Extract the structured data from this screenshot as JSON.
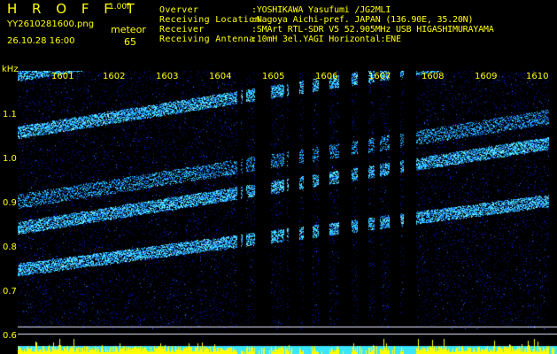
{
  "header": {
    "brand": "H R O F F T",
    "version": "1.00f",
    "filename": "YY2610281600.png",
    "timestamp": "26.10.28 16:00",
    "meteor_label": "meteor",
    "meteor_count": "65"
  },
  "station": {
    "labels": [
      "Overver",
      "Receiving Location",
      "Receiver",
      "Receiving Antenna"
    ],
    "values": [
      ":YOSHIKAWA Yasufumi /JG2MLI",
      ":Nagoya Aichi-pref. JAPAN (136.90E, 35.20N)",
      ":SMArt RTL-SDR V5 52.905MHz USB HIGASHIMURAYAMA",
      ":10mH 3el.YAGI Horizontal:ENE"
    ]
  },
  "axis": {
    "unit": "kHz",
    "freq_ticks": [
      "1.1",
      "1.0",
      "0.9",
      "0.8",
      "0.7",
      "0.6"
    ],
    "time_ticks": [
      "1601",
      "1602",
      "1603",
      "1604",
      "1605",
      "1606",
      "1607",
      "1608",
      "1609",
      "1610"
    ]
  },
  "colors": {
    "text": "#ffff00",
    "background": "#000000",
    "noise": "#0a14c8",
    "signal": "#39e6ff",
    "grid": "#ffffff",
    "activity_bar": "#ffff00"
  }
}
